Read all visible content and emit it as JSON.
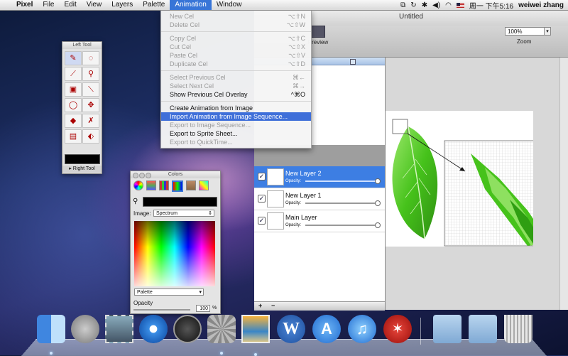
{
  "menubar": {
    "app_name": "Pixel",
    "menus": [
      "File",
      "Edit",
      "View",
      "Layers",
      "Palette",
      "Animation",
      "Window"
    ],
    "clock": "周一 下午5:16",
    "user": "weiwei zhang"
  },
  "animation_menu": {
    "new_cel": {
      "label": "New Cel",
      "shortcut": "⌥⇧N"
    },
    "delete_cel": {
      "label": "Delete Cel",
      "shortcut": "⌥⇧W"
    },
    "copy_cel": {
      "label": "Copy Cel",
      "shortcut": "⌥⇧C"
    },
    "cut_cel": {
      "label": "Cut Cel",
      "shortcut": "⌥⇧X"
    },
    "paste_cel": {
      "label": "Paste Cel",
      "shortcut": "⌥⇧V"
    },
    "duplicate_cel": {
      "label": "Duplicate Cel",
      "shortcut": "⌥⇧D"
    },
    "select_previous_cel": {
      "label": "Select Previous Cel",
      "shortcut": "⌘←"
    },
    "select_next_cel": {
      "label": "Select Next Cel",
      "shortcut": "⌘→"
    },
    "show_previous_cel_overlay": {
      "label": "Show Previous Cel Overlay",
      "shortcut": "^⌘O"
    },
    "create_from_image": {
      "label": "Create Animation from Image"
    },
    "import_from_sequence": {
      "label": "Import Animation from Image Sequence..."
    },
    "export_to_sequence": {
      "label": "Export to Image Sequence..."
    },
    "export_to_sprite": {
      "label": "Export to Sprite Sheet..."
    },
    "export_to_quicktime": {
      "label": "Export to QuickTime..."
    }
  },
  "document": {
    "title": "Untitled",
    "preview_label": "Preview",
    "zoom_value": "100%",
    "zoom_label": "Zoom"
  },
  "layers": [
    {
      "name": "New Layer 2",
      "opacity_label": "Opacity:",
      "visible": true,
      "selected": true,
      "opacity": 1.0
    },
    {
      "name": "New Layer 1",
      "opacity_label": "Opacity:",
      "visible": true,
      "selected": false,
      "opacity": 1.0
    },
    {
      "name": "Main Layer",
      "opacity_label": "Opacity:",
      "visible": true,
      "selected": false,
      "opacity": 1.0
    }
  ],
  "layer_buttons": {
    "add": "+",
    "remove": "−"
  },
  "left_tool": {
    "title": "Left Tool",
    "right_tool_label": "Right Tool",
    "tools": [
      "pencil-icon",
      "lasso-icon",
      "brush-icon",
      "magic-wand-icon",
      "select-rect-icon",
      "eyedropper-icon",
      "select-ellipse-icon",
      "move-icon",
      "bucket-icon",
      "eraser-icon",
      "stamp-icon",
      "replace-color-icon"
    ]
  },
  "colors_panel": {
    "title": "Colors",
    "image_label": "Image:",
    "image_value": "Spectrum",
    "palette_value": "Palette",
    "opacity_label": "Opacity",
    "opacity_value": "100",
    "opacity_unit": "%"
  },
  "dock": [
    "finder",
    "launchpad",
    "mail-stamp",
    "safari",
    "dashboard",
    "system-preferences",
    "iphoto",
    "word",
    "app-store",
    "itunes",
    "acrobat",
    "documents-folder",
    "downloads-folder",
    "trash"
  ],
  "colors": {
    "menu_highlight": "#3f6fd9",
    "leaf_green": "#46c21b",
    "selection_blue": "#3d7ee3"
  }
}
